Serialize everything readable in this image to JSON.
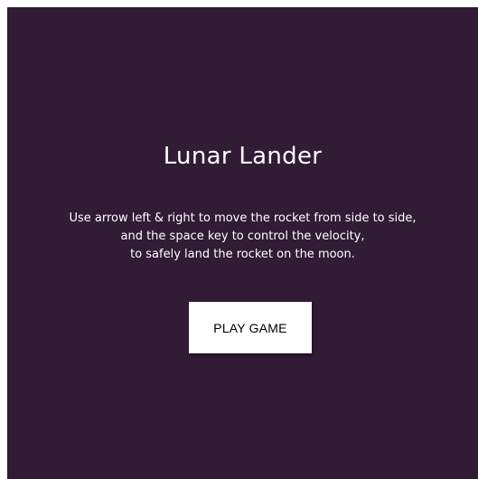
{
  "game": {
    "title": "Lunar Lander",
    "instructions": [
      "Use arrow left & right to move the rocket from side to side,",
      "and the space key to control the velocity,",
      "to safely land the rocket on the moon."
    ],
    "play_label": "PLAY GAME"
  },
  "colors": {
    "background": "#311b35",
    "text": "#ffffff",
    "button_bg": "#ffffff",
    "button_text": "#000000"
  }
}
